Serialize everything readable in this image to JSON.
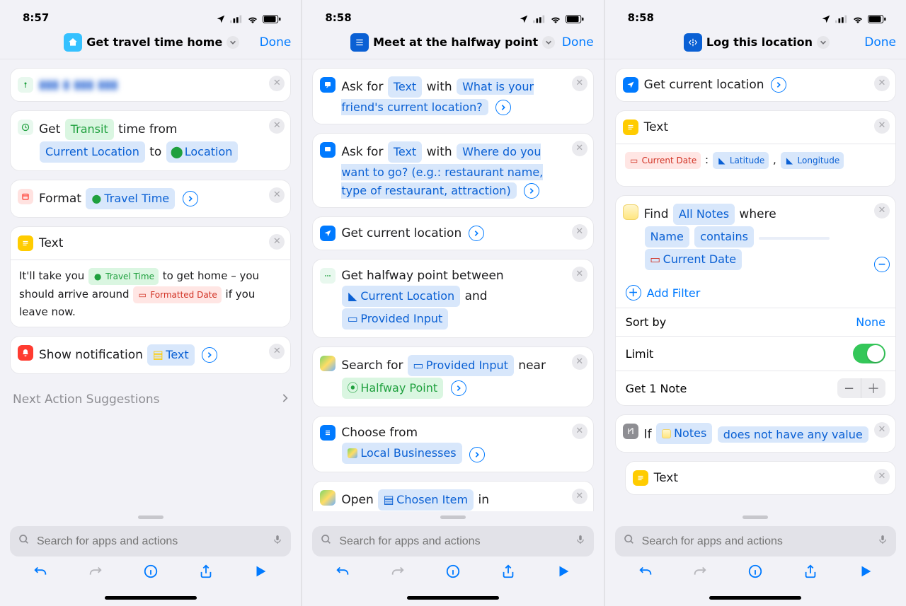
{
  "status": {
    "time1": "8:57",
    "time2": "8:58",
    "time3": "8:58"
  },
  "common": {
    "done": "Done",
    "search_placeholder": "Search for apps and actions",
    "next_suggestions": "Next Action Suggestions"
  },
  "phone1": {
    "title": "Get travel time home",
    "cards": {
      "travel": {
        "prefix": "Get ",
        "transit": "Transit",
        "mid": " time from ",
        "currentLoc": "Current Location",
        "to": " to ",
        "location": "Location"
      },
      "format": {
        "label": "Format ",
        "param": "Travel Time"
      },
      "text": {
        "title": "Text",
        "body_pre": "It'll take you ",
        "chip1": "Travel Time",
        "body_mid": " to get home – you should arrive around ",
        "chip2": "Formatted Date",
        "body_post": " if you leave now."
      },
      "notify": {
        "label": "Show notification ",
        "param": "Text"
      }
    }
  },
  "phone2": {
    "title": "Meet at the halfway point",
    "ask1": {
      "verb": "Ask for ",
      "type": "Text",
      "with": " with ",
      "prompt": "What is your friend's current location?"
    },
    "ask2": {
      "verb": "Ask for ",
      "type": "Text",
      "with": " with ",
      "prompt": "Where do you want to go? (e.g.: restaurant name, type of restaurant, attraction)"
    },
    "getloc": "Get current location",
    "halfway": {
      "pre": "Get halfway point between ",
      "a": "Current Location",
      "and": " and ",
      "b": "Provided Input"
    },
    "search": {
      "pre": "Search for ",
      "input": "Provided Input",
      "near": " near ",
      "point": "Halfway Point"
    },
    "choose": {
      "pre": "Choose from ",
      "list": "Local Businesses"
    },
    "open": {
      "pre": "Open ",
      "item": "Chosen Item",
      "post": " in"
    }
  },
  "phone3": {
    "title": "Log this location",
    "getloc": "Get current location",
    "text": {
      "title": "Text",
      "chips": {
        "date": "Current Date",
        "lat": "Latitude",
        "lon": "Longitude",
        "colon": " : ",
        "comma": " , "
      }
    },
    "find": {
      "pre": "Find ",
      "all": "All Notes",
      "where": " where",
      "name": "Name",
      "contains": "contains",
      "date": "Current Date",
      "add_filter": "Add Filter",
      "sort_label": "Sort by",
      "sort_value": "None",
      "limit_label": "Limit",
      "get_label": "Get 1 Note"
    },
    "if": {
      "pre": "If ",
      "notes": "Notes",
      "cond": "does not have any value"
    },
    "innerText": "Text"
  }
}
